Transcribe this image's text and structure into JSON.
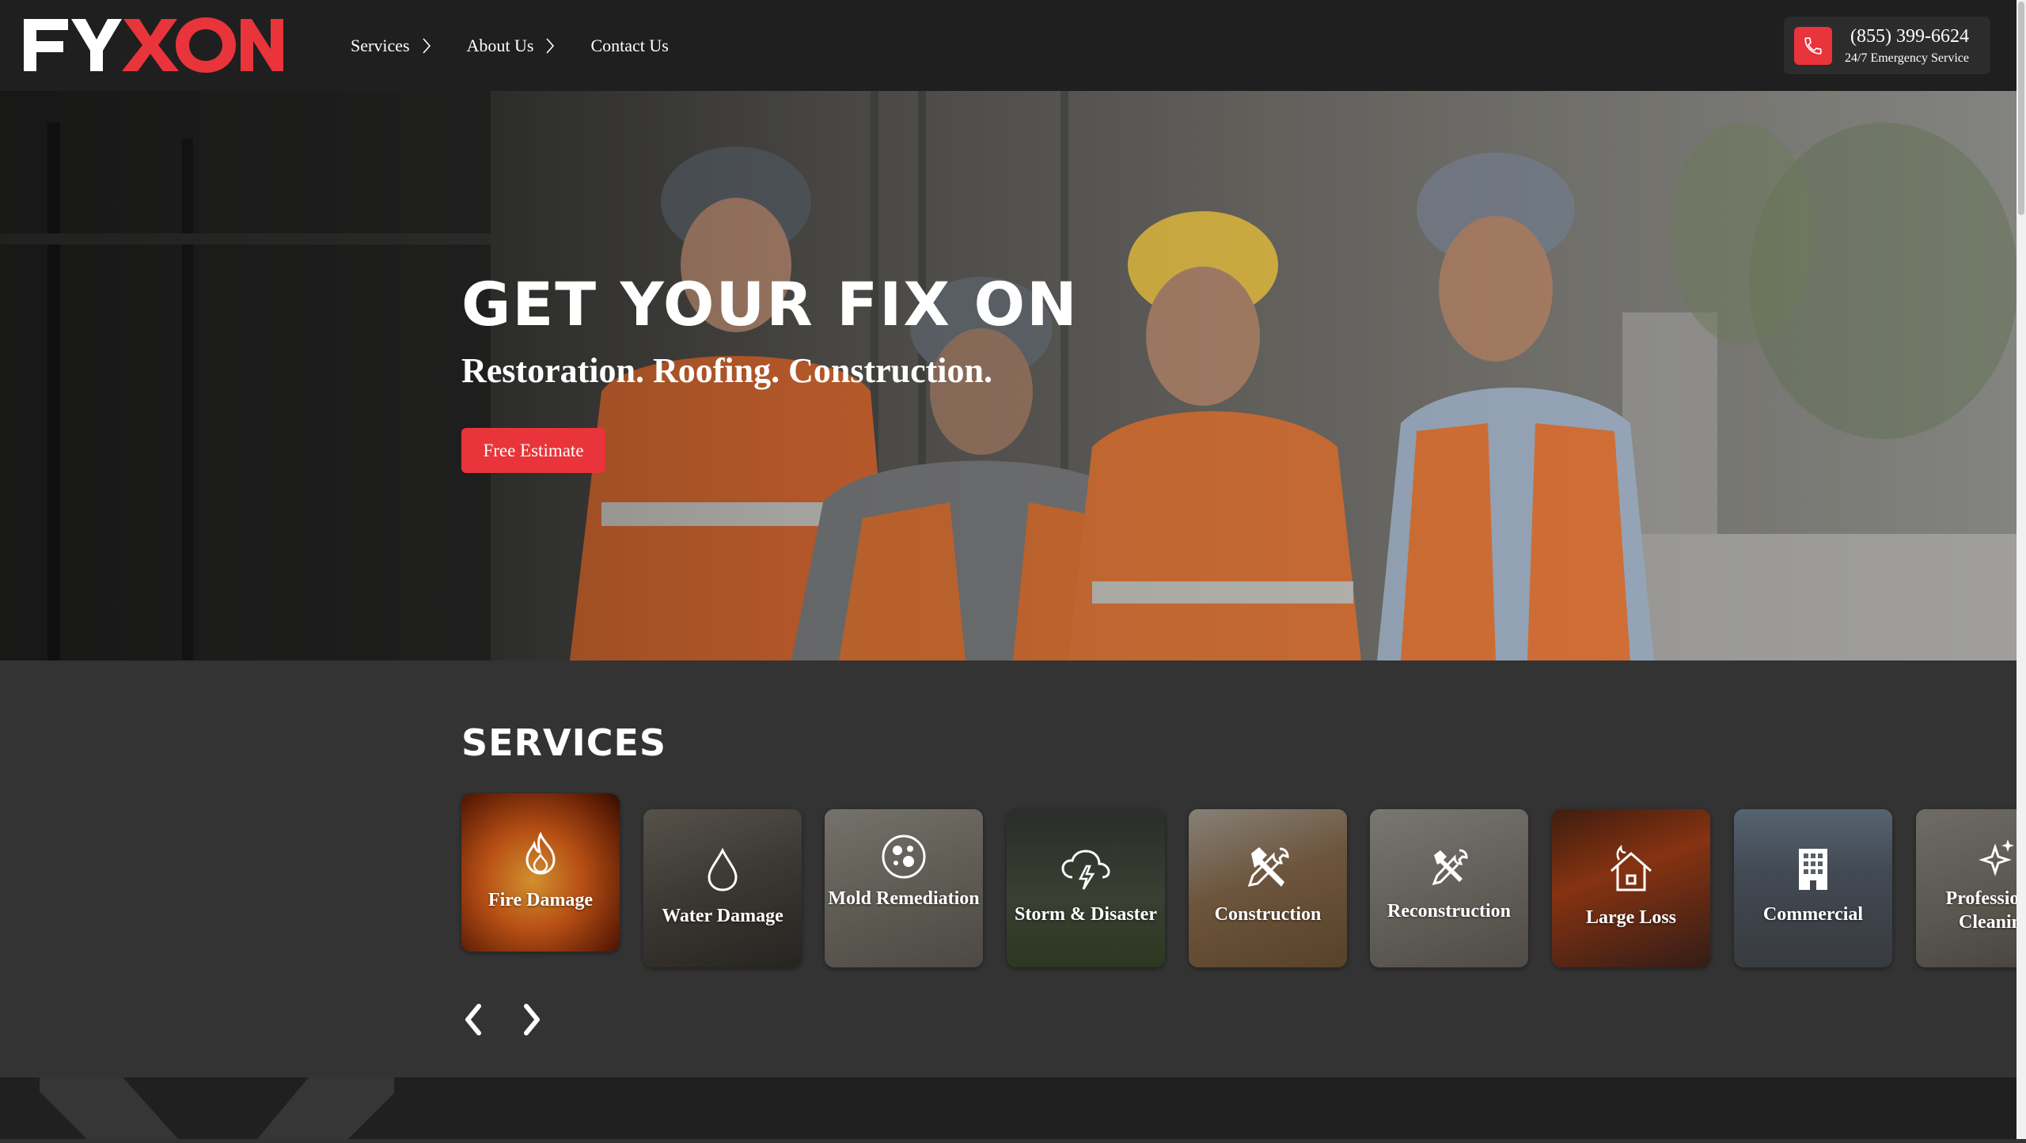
{
  "header": {
    "logo_text": "FYXON",
    "nav": [
      {
        "label": "Services",
        "has_chevron": true
      },
      {
        "label": "About Us",
        "has_chevron": true
      },
      {
        "label": "Contact Us",
        "has_chevron": false
      }
    ],
    "phone": {
      "number": "(855) 399-6624",
      "subtitle": "24/7 Emergency Service",
      "icon": "phone-icon"
    }
  },
  "hero": {
    "title": "GET YOUR FIX ON",
    "subtitle": "Restoration. Roofing. Construction.",
    "cta_label": "Free Estimate"
  },
  "services": {
    "title": "SERVICES",
    "cards": [
      {
        "label": "Fire Damage",
        "icon": "flame-icon"
      },
      {
        "label": "Water Damage",
        "icon": "water-drop-icon"
      },
      {
        "label": "Mold Remediation",
        "icon": "mold-icon"
      },
      {
        "label": "Storm & Disaster",
        "icon": "storm-cloud-icon"
      },
      {
        "label": "Construction",
        "icon": "hammer-wrench-icon"
      },
      {
        "label": "Reconstruction",
        "icon": "tools-icon"
      },
      {
        "label": "Large Loss",
        "icon": "house-fire-icon"
      },
      {
        "label": "Commercial",
        "icon": "building-icon"
      },
      {
        "label": "Professional Cleaning",
        "icon": "sparkle-icon"
      }
    ],
    "prev_icon": "chevron-left-icon",
    "next_icon": "chevron-right-icon"
  },
  "colors": {
    "accent": "#e8343a",
    "header_bg": "#1f1f1f",
    "section_bg": "#333333"
  }
}
